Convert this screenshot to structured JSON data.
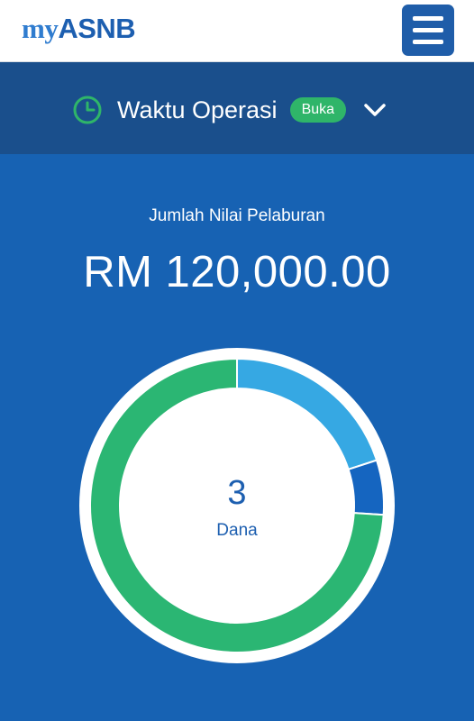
{
  "header": {
    "logo_prefix": "my",
    "logo_brand": "ASNB",
    "menu_icon": "hamburger-menu-icon"
  },
  "operating_hours": {
    "icon": "clock-icon",
    "title": "Waktu Operasi",
    "status": "Buka",
    "expand_icon": "chevron-down-icon"
  },
  "investment": {
    "label": "Jumlah Nilai Pelaburan",
    "amount": "RM 120,000.00"
  },
  "chart_data": {
    "type": "pie",
    "style": "donut",
    "center_value": "3",
    "center_label": "Dana",
    "values": [
      0.2,
      0.06,
      0.74
    ],
    "colors": [
      "#36a8e3",
      "#1565c0",
      "#2bb673"
    ]
  },
  "colors": {
    "page_background": "#1762b3",
    "ops_background": "#1a4f8c",
    "status_green": "#2fb569",
    "brand_blue": "#1d5fb0"
  }
}
